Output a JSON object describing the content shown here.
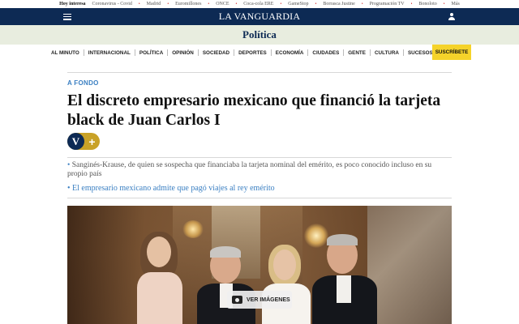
{
  "topbar": {
    "lead": "Hoy interesa",
    "topics": [
      "Coronavirus - Covid",
      "Madrid",
      "Euromillones",
      "ONCE",
      "Coca-cola ERE",
      "GameStop",
      "Borrasca Justine",
      "Programación TV",
      "Bonoloto",
      "Más"
    ]
  },
  "masthead": {
    "logo": "LA VANGUARDIA"
  },
  "section": {
    "title": "Política"
  },
  "nav": {
    "items": [
      "AL MINUTO",
      "INTERNACIONAL",
      "POLÍTICA",
      "OPINIÓN",
      "SOCIEDAD",
      "DEPORTES",
      "ECONOMÍA",
      "CIUDADES",
      "GENTE",
      "CULTURA",
      "SUCESOS"
    ],
    "subscribe": "SUSCRÍBETE"
  },
  "article": {
    "kicker": "A FONDO",
    "headline": "El discreto empresario mexicano que financió la tarjeta black de Juan Carlos I",
    "badge_letter": "V",
    "badge_plus": "+",
    "summary": "Sanginés-Krause, de quien se sospecha que financiaba la tarjeta nominal del emérito, es poco conocido incluso en su propio país",
    "related": "El empresario mexicano admite que pagó viajes al rey emérito",
    "view_images": "VER IMÁGENES"
  },
  "colors": {
    "masthead": "#0d2a54",
    "section_bar": "#e8eddf",
    "accent": "#3a7fc2",
    "subscribe": "#f5d32a",
    "badge_gold": "#c9a227"
  },
  "icons": {
    "menu": "hamburger-icon",
    "user": "user-icon",
    "camera": "camera-icon"
  }
}
